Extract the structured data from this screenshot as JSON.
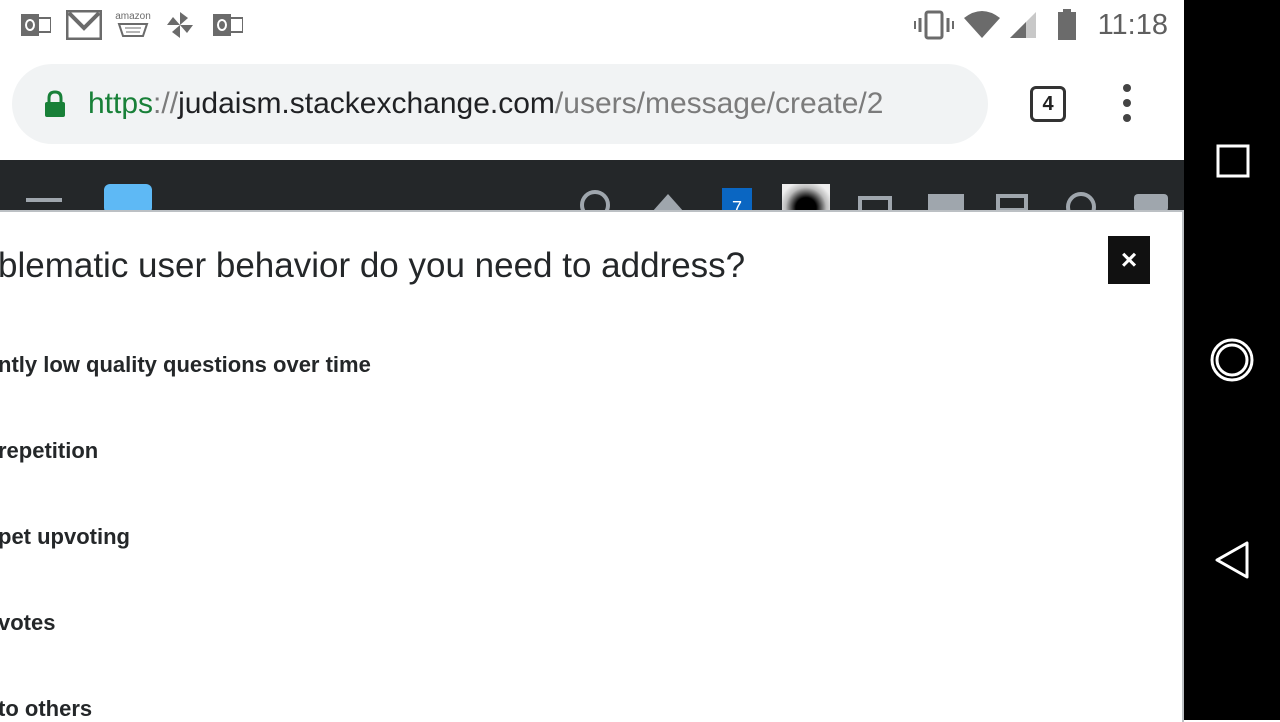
{
  "status_bar": {
    "time": "11:18",
    "notification_icons": [
      "outlook-icon",
      "gmail-icon",
      "amazon-icon",
      "pinwheel-icon",
      "outlook-icon"
    ],
    "amazon_text": "amazon",
    "system_icons": [
      "vibrate-icon",
      "wifi-icon",
      "cell-signal-icon",
      "battery-icon"
    ]
  },
  "browser": {
    "url_scheme": "https",
    "url_sep": "://",
    "url_host": "judaism.stackexchange.com",
    "url_path": "/users/message/create/2",
    "tab_count": "4"
  },
  "se_topbar": {
    "inbox_count": "7"
  },
  "dialog": {
    "title": "blematic user behavior do you need to address?",
    "close_label": "×",
    "options": [
      "ntly low quality questions over time",
      " repetition",
      "pet upvoting",
      " votes",
      "to others"
    ]
  },
  "nav_bar": {
    "buttons": [
      "recents-square-icon",
      "home-circle-icon",
      "back-triangle-icon"
    ]
  }
}
